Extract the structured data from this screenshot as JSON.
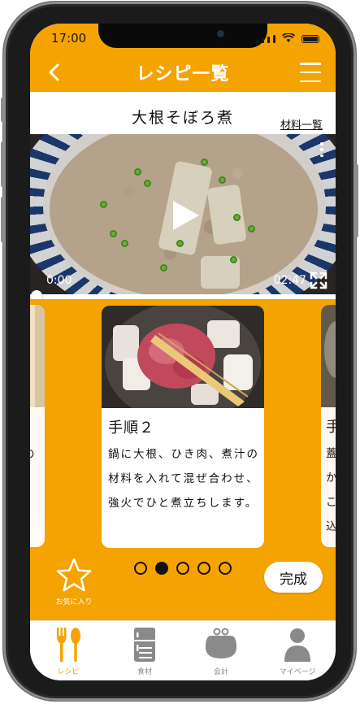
{
  "status_bar": {
    "time": "17:00"
  },
  "header": {
    "title": "レシピ一覧",
    "back_icon": "chevron-left-icon",
    "menu_icon": "hamburger-menu-icon"
  },
  "recipe": {
    "title": "大根そぼろ煮",
    "ingredients_link": "材料一覧"
  },
  "video": {
    "current_time": "0:00",
    "total_time": "02:47",
    "progress": 0.0,
    "play_icon": "play-icon",
    "more_icon": "more-vertical-icon",
    "fullscreen_icon": "fullscreen-icon"
  },
  "steps": {
    "current": {
      "label": "手順２",
      "text": "鍋に大根、ひき肉、煮汁の材料を入れて混ぜ合わせ、強火でひと煮立ちします。"
    },
    "previous_partial": {
      "text_fragment": "の"
    },
    "next_partial": {
      "label_fragment": "手",
      "text_fragment": "蓋かこ込"
    },
    "pager": {
      "count": 5,
      "active_index": 1
    }
  },
  "favorite": {
    "label": "お気に入り",
    "icon": "star-icon"
  },
  "done_button": {
    "label": "完成"
  },
  "tab_bar": {
    "items": [
      {
        "label": "レシピ",
        "icon": "fork-spoon-icon",
        "active": true
      },
      {
        "label": "食材",
        "icon": "fridge-icon",
        "active": false
      },
      {
        "label": "会計",
        "icon": "wallet-icon",
        "active": false
      },
      {
        "label": "マイページ",
        "icon": "user-icon",
        "active": false
      }
    ]
  },
  "colors": {
    "accent": "#f5a300",
    "tab_inactive": "#8a8a8a",
    "text": "#111111"
  }
}
